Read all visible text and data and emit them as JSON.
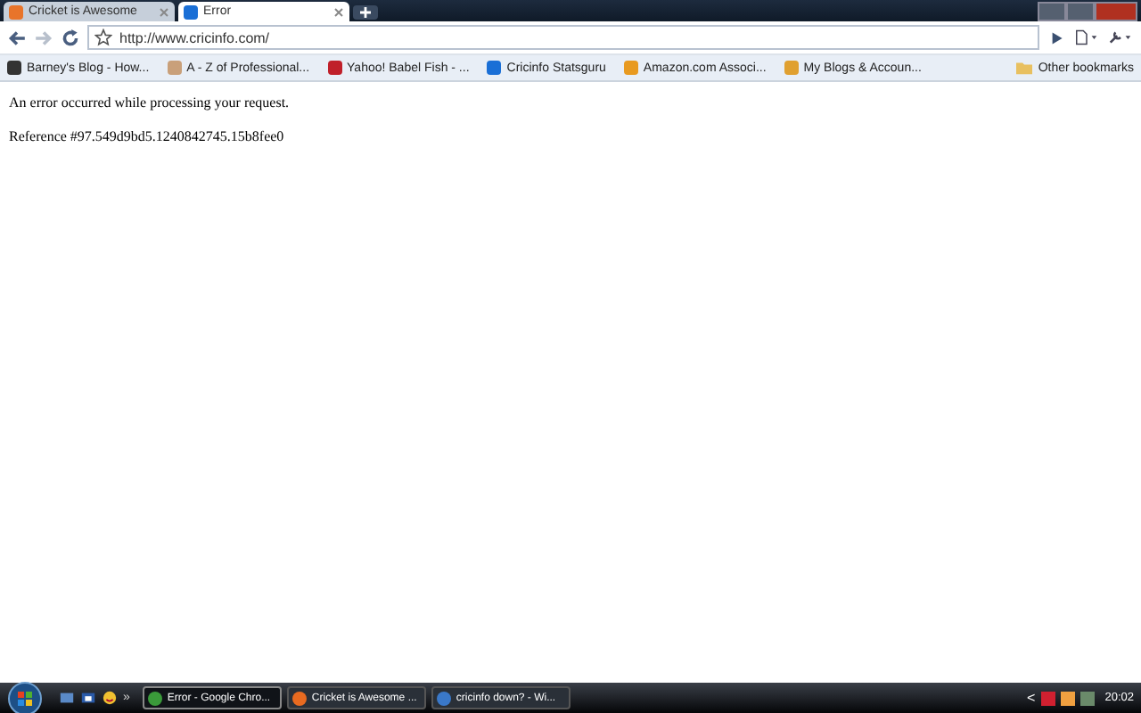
{
  "tabs": [
    {
      "title": "Cricket is Awesome",
      "selected": false
    },
    {
      "title": "Error",
      "selected": true
    }
  ],
  "address": {
    "value": "http://www.cricinfo.com/"
  },
  "bookmarks": [
    {
      "label": "Barney's Blog - How..."
    },
    {
      "label": "A - Z of Professional..."
    },
    {
      "label": "Yahoo! Babel Fish - ..."
    },
    {
      "label": "Cricinfo Statsguru"
    },
    {
      "label": "Amazon.com Associ..."
    },
    {
      "label": "My Blogs & Accoun..."
    }
  ],
  "other_bookmarks": "Other bookmarks",
  "page": {
    "lines": [
      "An error occurred while processing your request.",
      "Reference #97.549d9bd5.1240842745.15b8fee0"
    ]
  },
  "taskbar": {
    "overflow": "»",
    "windows": [
      {
        "title": "Error - Google Chro...",
        "selected": true
      },
      {
        "title": "Cricket is Awesome ...",
        "selected": false
      },
      {
        "title": "cricinfo down? - Wi...",
        "selected": false
      }
    ],
    "tray_arrow": "<",
    "clock": "20:02"
  }
}
